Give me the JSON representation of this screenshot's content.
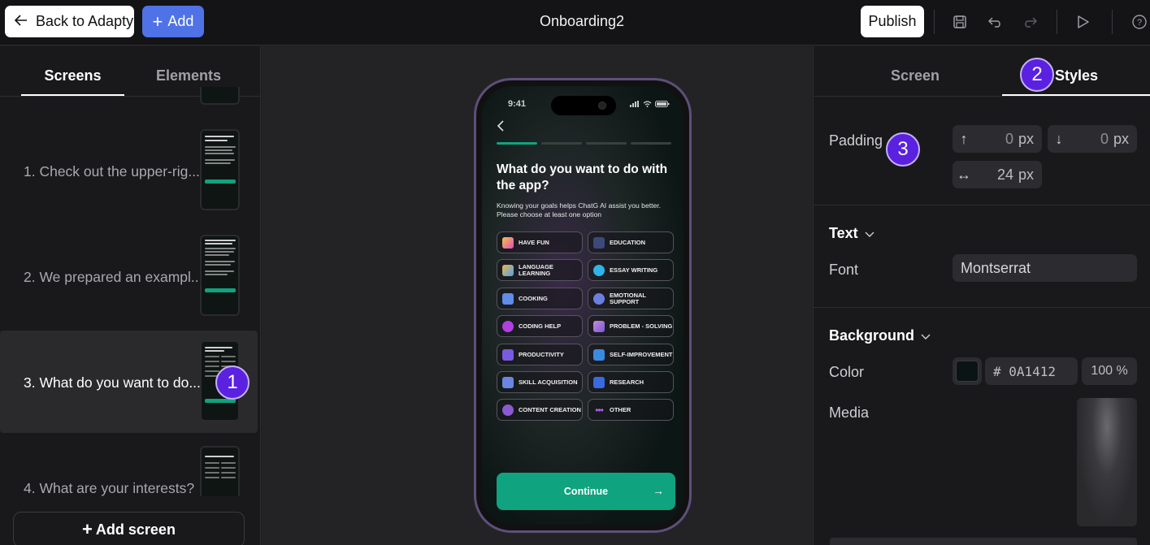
{
  "topbar": {
    "back_label": "Back to Adapty",
    "add_label": "Add",
    "title": "Onboarding2",
    "publish_label": "Publish"
  },
  "left_panel": {
    "tabs": [
      {
        "label": "Screens",
        "active": true
      },
      {
        "label": "Elements",
        "active": false
      }
    ],
    "screens": [
      {
        "label": "1. Check out the upper-rig..."
      },
      {
        "label": "2. We prepared an exampl..."
      },
      {
        "label": "3. What do you want to do...",
        "active": true
      },
      {
        "label": "4. What are your interests?"
      }
    ],
    "add_screen_label": "Add screen"
  },
  "phone": {
    "time": "9:41",
    "title": "What do you want to do with the app?",
    "subtitle": "Knowing your goals helps ChatG AI assist you better. Please choose at least one option",
    "options": [
      {
        "label": "HAVE FUN",
        "icon": "party-icon"
      },
      {
        "label": "EDUCATION",
        "icon": "graduation-cap-icon"
      },
      {
        "label": "LANGUAGE LEARNING",
        "icon": "language-icon"
      },
      {
        "label": "ESSAY WRITING",
        "icon": "pen-icon"
      },
      {
        "label": "COOKING",
        "icon": "chef-hat-icon"
      },
      {
        "label": "EMOTIONAL SUPPORT",
        "icon": "head-icon"
      },
      {
        "label": "CODING HELP",
        "icon": "code-icon"
      },
      {
        "label": "PROBLEM - SOLVING",
        "icon": "puzzle-icon"
      },
      {
        "label": "PRODUCTIVITY",
        "icon": "chart-icon"
      },
      {
        "label": "SELF-IMPROVEMENT",
        "icon": "person-icon"
      },
      {
        "label": "SKILL ACQUISITION",
        "icon": "student-icon"
      },
      {
        "label": "RESEARCH",
        "icon": "research-icon"
      },
      {
        "label": "CONTENT CREATION",
        "icon": "creator-icon"
      },
      {
        "label": "OTHER",
        "icon": "dots-icon"
      }
    ],
    "continue_label": "Continue",
    "accent_color": "#10A37F"
  },
  "right_panel": {
    "tabs": [
      {
        "label": "Screen",
        "active": false
      },
      {
        "label": "Styles",
        "active": true
      }
    ],
    "padding": {
      "label": "Padding",
      "top": {
        "value": "0",
        "unit": "px"
      },
      "bottom": {
        "value": "0",
        "unit": "px"
      },
      "horizontal": {
        "value": "24",
        "unit": "px"
      }
    },
    "text_section": {
      "title": "Text",
      "font_label": "Font",
      "font_value": "Montserrat"
    },
    "background_section": {
      "title": "Background",
      "color_label": "Color",
      "color_hex": "# 0A1412",
      "opacity": "100 %",
      "media_label": "Media"
    }
  },
  "annotations": [
    "1",
    "2",
    "3"
  ]
}
